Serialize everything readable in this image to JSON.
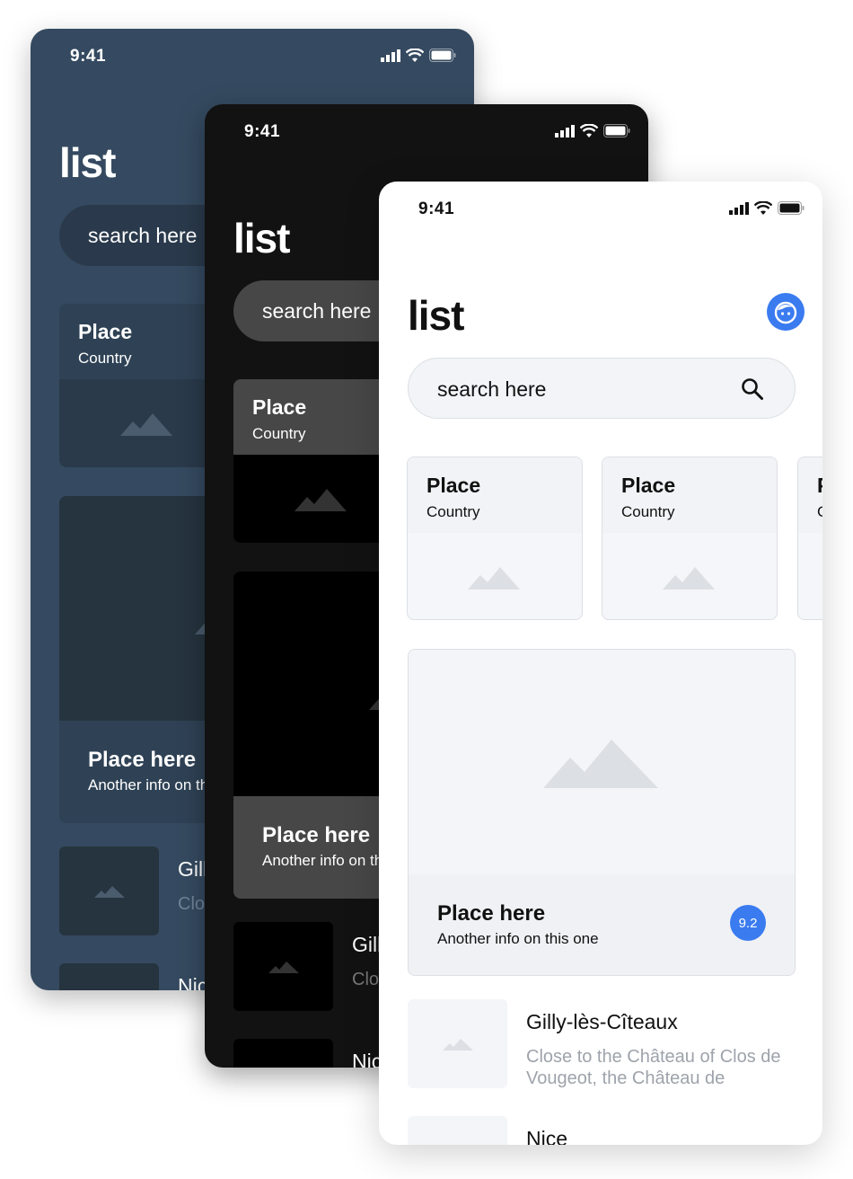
{
  "status": {
    "time": "9:41"
  },
  "page": {
    "title": "list"
  },
  "search": {
    "placeholder": "search here"
  },
  "cards": [
    {
      "title": "Place",
      "subtitle": "Country"
    },
    {
      "title": "Place",
      "subtitle": "Country"
    },
    {
      "title": "P",
      "subtitle": "C"
    }
  ],
  "featured": {
    "title": "Place here",
    "subtitle": "Another info on this one",
    "rating": "9.2"
  },
  "list": [
    {
      "title": "Gilly-lès-Cîteaux",
      "description": "Close to the Château of Clos de Vougeot, the Château de"
    },
    {
      "title": "Nice",
      "description": ""
    }
  ],
  "background_mockups": {
    "navy": {
      "cards": [
        {
          "title": "Place",
          "subtitle": "Country"
        }
      ],
      "featured": {
        "title": "Place here",
        "subtitle": "Another info on th"
      },
      "list": [
        {
          "title": "Gill",
          "description": "Clo de "
        },
        {
          "title": "Nic",
          "description": ""
        }
      ]
    },
    "black": {
      "cards": [
        {
          "title": "Place",
          "subtitle": "Country"
        }
      ],
      "featured": {
        "title": "Place here",
        "subtitle": "Another info on th"
      },
      "list": [
        {
          "title": "Gill",
          "description": "Clo de "
        },
        {
          "title": "Nic",
          "description": ""
        }
      ]
    }
  },
  "themes": {
    "navy": "#354a60",
    "black": "#121212",
    "light": "#ffffff",
    "accent": "#3a7bf0"
  },
  "icons": [
    "signal-icon",
    "wifi-icon",
    "battery-icon",
    "search-icon",
    "avatar-icon",
    "image-placeholder-icon"
  ]
}
